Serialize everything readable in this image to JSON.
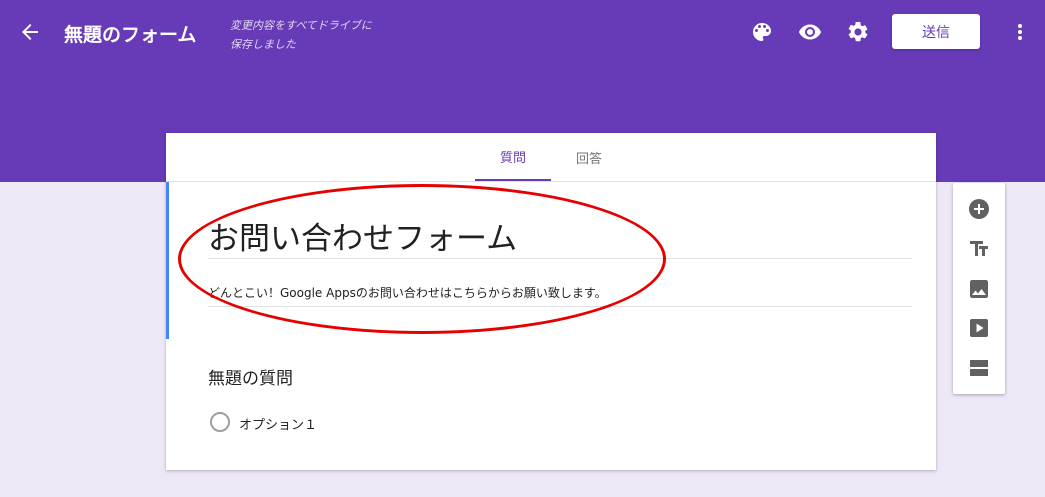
{
  "header": {
    "title": "無題のフォーム",
    "saved_status_line1": "変更内容をすべてドライブに",
    "saved_status_line2": "保存しました",
    "send_label": "送信",
    "icons": [
      "back-arrow-icon",
      "palette-icon",
      "preview-eye-icon",
      "settings-gear-icon",
      "more-vert-icon"
    ]
  },
  "tabs": [
    {
      "label": "質問",
      "active": true
    },
    {
      "label": "回答",
      "active": false
    }
  ],
  "form": {
    "title": "お問い合わせフォーム",
    "description": "どんとこい！Google Appsのお問い合わせはこちらからお願い致します。"
  },
  "question": {
    "title": "無題の質問",
    "option_label": "オプション１"
  },
  "toolbar": {
    "icons": [
      "add-circle-icon",
      "title-text-icon",
      "image-icon",
      "video-icon",
      "section-icon"
    ]
  },
  "colors": {
    "brand": "#673ab7",
    "background": "#ede7f6",
    "accent_blue": "#4285f4",
    "annotation_red": "#e60000"
  }
}
